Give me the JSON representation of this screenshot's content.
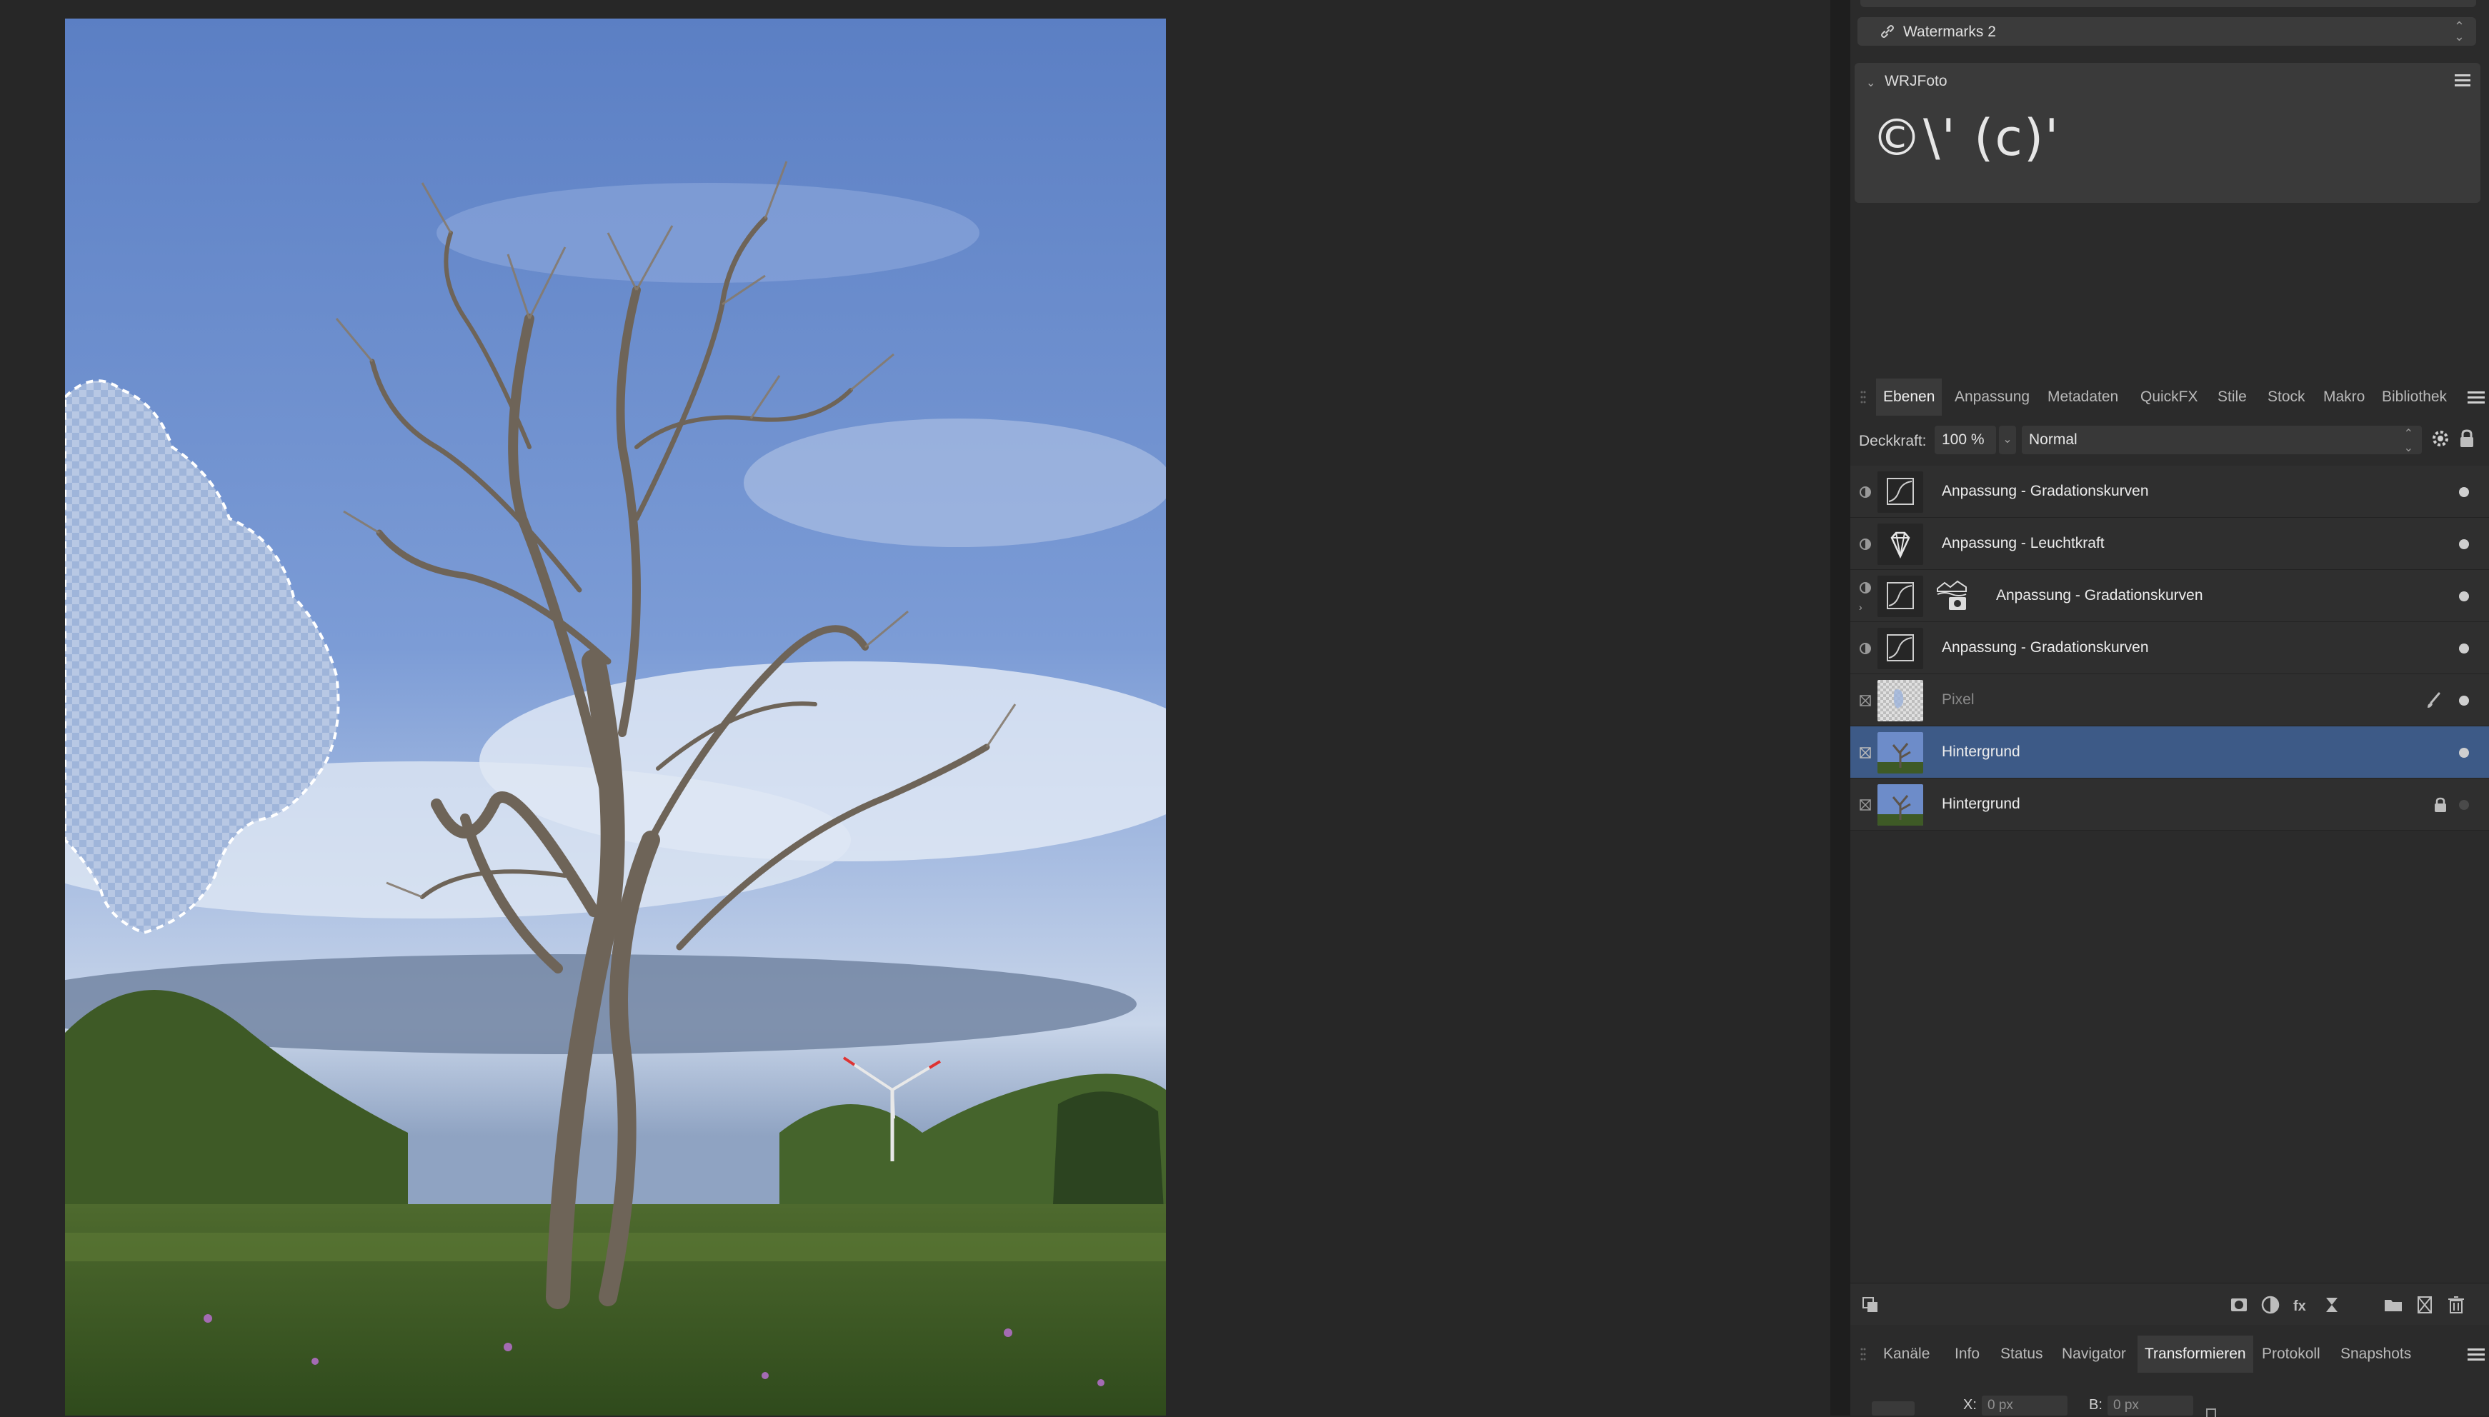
{
  "canvas": {
    "image_alt": "Photo: bare dead tree against a blue cloudy sky with green meadow and a wind turbine"
  },
  "watermark_panel": {
    "selected_library": "Watermarks 2",
    "card_title": "WRJFoto",
    "card_sample": "©\\' (c)'"
  },
  "layers_tabs": {
    "tabs": [
      "Ebenen",
      "Anpassung",
      "Metadaten",
      "QuickFX",
      "Stile",
      "Stock",
      "Makro",
      "Bibliothek"
    ],
    "active": "Ebenen"
  },
  "layer_controls": {
    "opacity_label": "Deckkraft:",
    "opacity_value": "100 %",
    "blend_mode": "Normal"
  },
  "layers": [
    {
      "name": "Anpassung - Gradationskurven",
      "type": "adjustment",
      "icon": "curves-icon",
      "visible": true
    },
    {
      "name": "Anpassung - Leuchtkraft",
      "type": "adjustment",
      "icon": "vibrance-icon",
      "visible": true
    },
    {
      "name": "Anpassung - Gradationskurven",
      "type": "adjustment-masked",
      "icon": "curves-icon",
      "visible": true
    },
    {
      "name": "Anpassung - Gradationskurven",
      "type": "adjustment",
      "icon": "curves-icon",
      "visible": true
    },
    {
      "name": "Pixel",
      "type": "pixel",
      "icon": "brush-icon",
      "visible": true,
      "dimmed": true
    },
    {
      "name": "Hintergrund",
      "type": "pixel",
      "visible": true,
      "selected": true
    },
    {
      "name": "Hintergrund",
      "type": "pixel",
      "visible": false,
      "locked": true
    }
  ],
  "bottom_tabs": {
    "tabs": [
      "Kanäle",
      "Info",
      "Status",
      "Navigator",
      "Transformieren",
      "Protokoll",
      "Snapshots"
    ],
    "active": "Transformieren"
  },
  "transform": {
    "x_label": "X:",
    "x_value": "0 px",
    "b_label": "B:",
    "b_value": "0 px"
  },
  "colors": {
    "selection_highlight": "#3d5a87",
    "panel_bg": "#2b2b2b",
    "app_bg": "#272727"
  }
}
